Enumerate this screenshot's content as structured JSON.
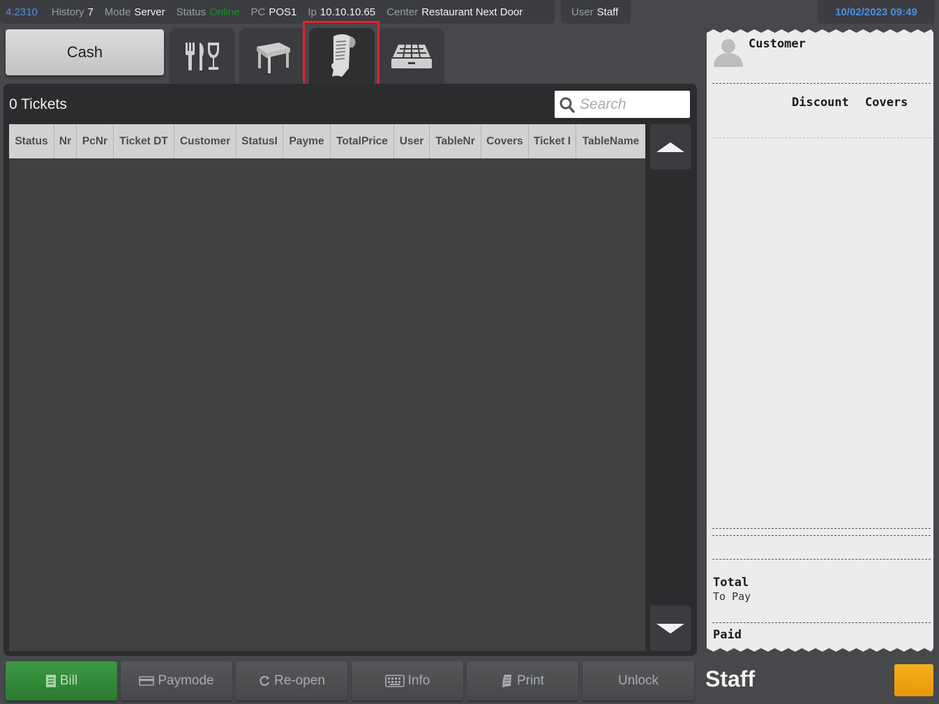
{
  "status_bar": {
    "version": "4.2310",
    "history_label": "History",
    "history_value": "7",
    "mode_label": "Mode",
    "mode_value": "Server",
    "status_label": "Status",
    "status_value": "Online",
    "pc_label": "PC",
    "pc_value": "POS1",
    "ip_label": "Ip",
    "ip_value": "10.10.10.65",
    "center_label": "Center",
    "center_value": "Restaurant Next Door",
    "user_label": "User",
    "user_value": "Staff",
    "datetime": "10/02/2023 09:49"
  },
  "toolbar": {
    "cash_label": "Cash",
    "tabs": [
      {
        "name": "menu-tab",
        "icon": "fork-knife-glass-icon"
      },
      {
        "name": "tables-tab",
        "icon": "table-icon"
      },
      {
        "name": "tickets-tab",
        "icon": "receipt-icon",
        "active": true
      },
      {
        "name": "cash-drawer-tab",
        "icon": "cash-drawer-icon"
      }
    ]
  },
  "tickets": {
    "count_label": "0 Tickets",
    "search_placeholder": "Search",
    "columns": [
      "Status",
      "Nr",
      "PcNr",
      "Ticket DT",
      "Customer",
      "StatusI",
      "Payme",
      "TotalPrice",
      "User",
      "TableNr",
      "Covers",
      "Ticket I",
      "TableName"
    ],
    "rows": []
  },
  "bottom_bar": {
    "bill": "Bill",
    "paymode": "Paymode",
    "reopen": "Re-open",
    "info": "Info",
    "print": "Print",
    "unlock": "Unlock"
  },
  "receipt": {
    "customer_label": "Customer",
    "discount_label": "Discount",
    "covers_label": "Covers",
    "total_label": "Total",
    "to_pay_label": "To Pay",
    "paid_label": "Paid"
  },
  "staff": {
    "name": "Staff",
    "color": "#f2a515"
  },
  "colors": {
    "accent_blue": "#4c8fe0",
    "online_green": "#1f8a2a",
    "highlight_red": "#e8202a",
    "bill_green": "#2f8a36"
  }
}
